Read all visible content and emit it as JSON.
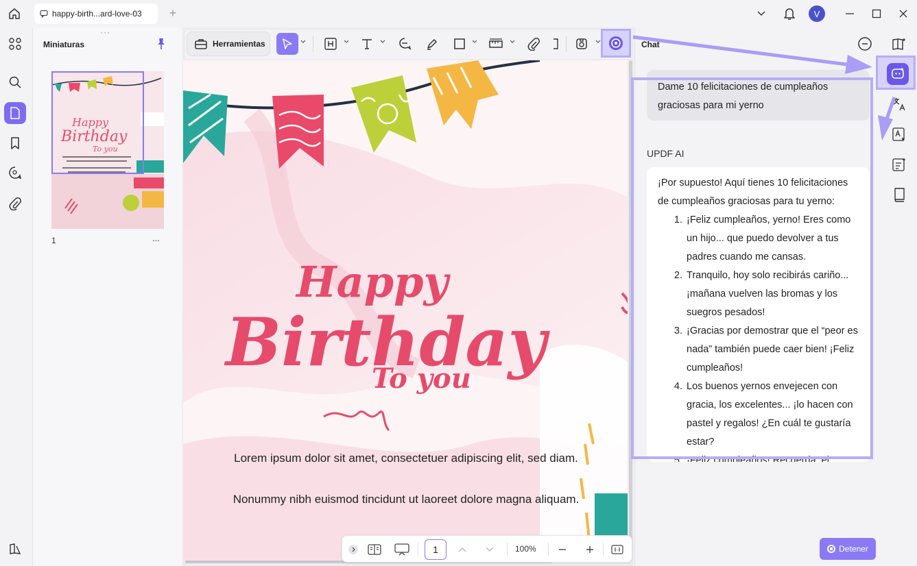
{
  "titlebar": {
    "tab_title": "happy-birth...ard-love-03",
    "avatar_letter": "V"
  },
  "thumbnails": {
    "title": "Miniaturas",
    "page_number": "1",
    "more_label": "..."
  },
  "toolbar": {
    "tools_label": "Herramientas"
  },
  "document": {
    "heading_happy": "Happy",
    "heading_birthday": "Birthday",
    "heading_to_you": "To you",
    "paragraph1": "Lorem ipsum dolor sit amet, consectetuer adipiscing elit, sed diam.",
    "paragraph2": "Nonummy nibh euismod tincidunt ut laoreet dolore magna aliquam."
  },
  "pagebar": {
    "page_value": "1",
    "zoom": "100%"
  },
  "chat": {
    "title": "Chat",
    "user_message": "Dame 10 felicitaciones de cumpleaños graciosas para mi yerno",
    "ai_label": "UPDF AI",
    "ai_intro": "¡Por supuesto! Aquí tienes 10 felicitaciones de cumpleaños graciosas para tu yerno:",
    "ai_items": [
      "¡Feliz cumpleaños, yerno! Eres como un hijo... que puedo devolver a tus padres cuando me cansas.",
      "Tranquilo, hoy solo recibirás cariño... ¡mañana vuelven las bromas y los suegros pesados!",
      "¡Gracias por demostrar que el “peor es nada” también puede caer bien! ¡Feliz cumpleaños!",
      "Los buenos yernos envejecen con gracia, los excelentes... ¡lo hacen con pastel y regalos! ¿En cuál te gustaría estar?",
      "¡Feliz cumpleaños! Recuerda: el"
    ],
    "stop_label": "Detener"
  },
  "colors": {
    "accent": "#8a7af5",
    "highlight": "#b6adf7",
    "ai_button": "#6a58e8"
  }
}
